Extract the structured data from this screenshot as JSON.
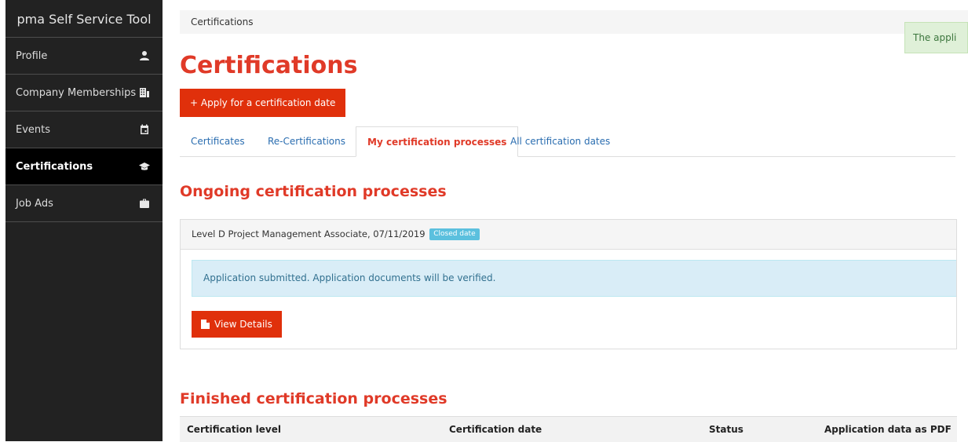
{
  "sidebar": {
    "brand": "pma Self Service Tool",
    "items": [
      {
        "label": "Profile",
        "icon": "user-icon",
        "active": false
      },
      {
        "label": "Company Memberships",
        "icon": "building-icon",
        "active": false
      },
      {
        "label": "Events",
        "icon": "calendar-icon",
        "active": false
      },
      {
        "label": "Certifications",
        "icon": "graduation-cap-icon",
        "active": true
      },
      {
        "label": "Job Ads",
        "icon": "briefcase-icon",
        "active": false
      }
    ]
  },
  "breadcrumb": "Certifications",
  "toast": "The appli",
  "page_title": "Certifications",
  "apply_button": "+ Apply for a certification date",
  "tabs": [
    {
      "label": "Certificates",
      "active": false
    },
    {
      "label": "Re-Certifications",
      "active": false
    },
    {
      "label": "My certification processes",
      "active": true
    },
    {
      "label": "All certification dates",
      "active": false
    }
  ],
  "ongoing": {
    "title": "Ongoing certification processes",
    "process": {
      "heading": "Level D Project Management Associate, 07/11/2019",
      "badge": "Closed date",
      "alert": "Application submitted. Application documents will be verified.",
      "details_button": "View Details"
    }
  },
  "finished": {
    "title": "Finished certification processes",
    "columns": [
      "Certification level",
      "Certification date",
      "Status",
      "Application data as PDF"
    ]
  },
  "colors": {
    "accent": "#e03a28",
    "button": "#e0300b",
    "sidebar": "#222222",
    "link": "#2a6db0",
    "badge": "#5bc0de"
  }
}
